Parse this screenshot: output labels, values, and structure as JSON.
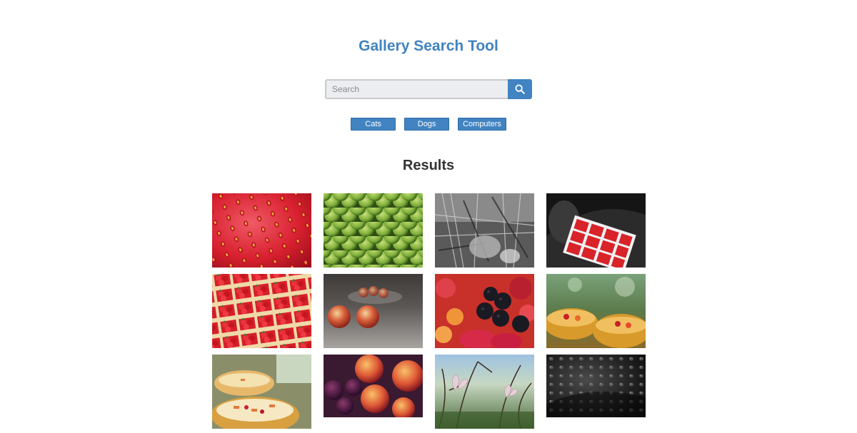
{
  "header": {
    "title": "Gallery Search Tool"
  },
  "search": {
    "placeholder": "Search",
    "value": "",
    "button_icon": "search-icon"
  },
  "filters": [
    {
      "label": "Cats"
    },
    {
      "label": "Dogs"
    },
    {
      "label": "Computers"
    }
  ],
  "results": {
    "heading": "Results",
    "images": [
      {
        "subject": "strawberry-closeup"
      },
      {
        "subject": "green-figs"
      },
      {
        "subject": "black-and-white-workshop"
      },
      {
        "subject": "strawberry-crates-in-car"
      },
      {
        "subject": "strawberry-baskets"
      },
      {
        "subject": "peaches-on-table"
      },
      {
        "subject": "mixed-berries"
      },
      {
        "subject": "fruit-bowls"
      },
      {
        "subject": "pasta-bowls"
      },
      {
        "subject": "peaches-and-plums"
      },
      {
        "subject": "pasqueflower-plants"
      },
      {
        "subject": "water-droplets-on-dark-surface"
      }
    ]
  },
  "colors": {
    "accent": "#4183c0",
    "button": "#4184c1",
    "heading": "#333333"
  }
}
